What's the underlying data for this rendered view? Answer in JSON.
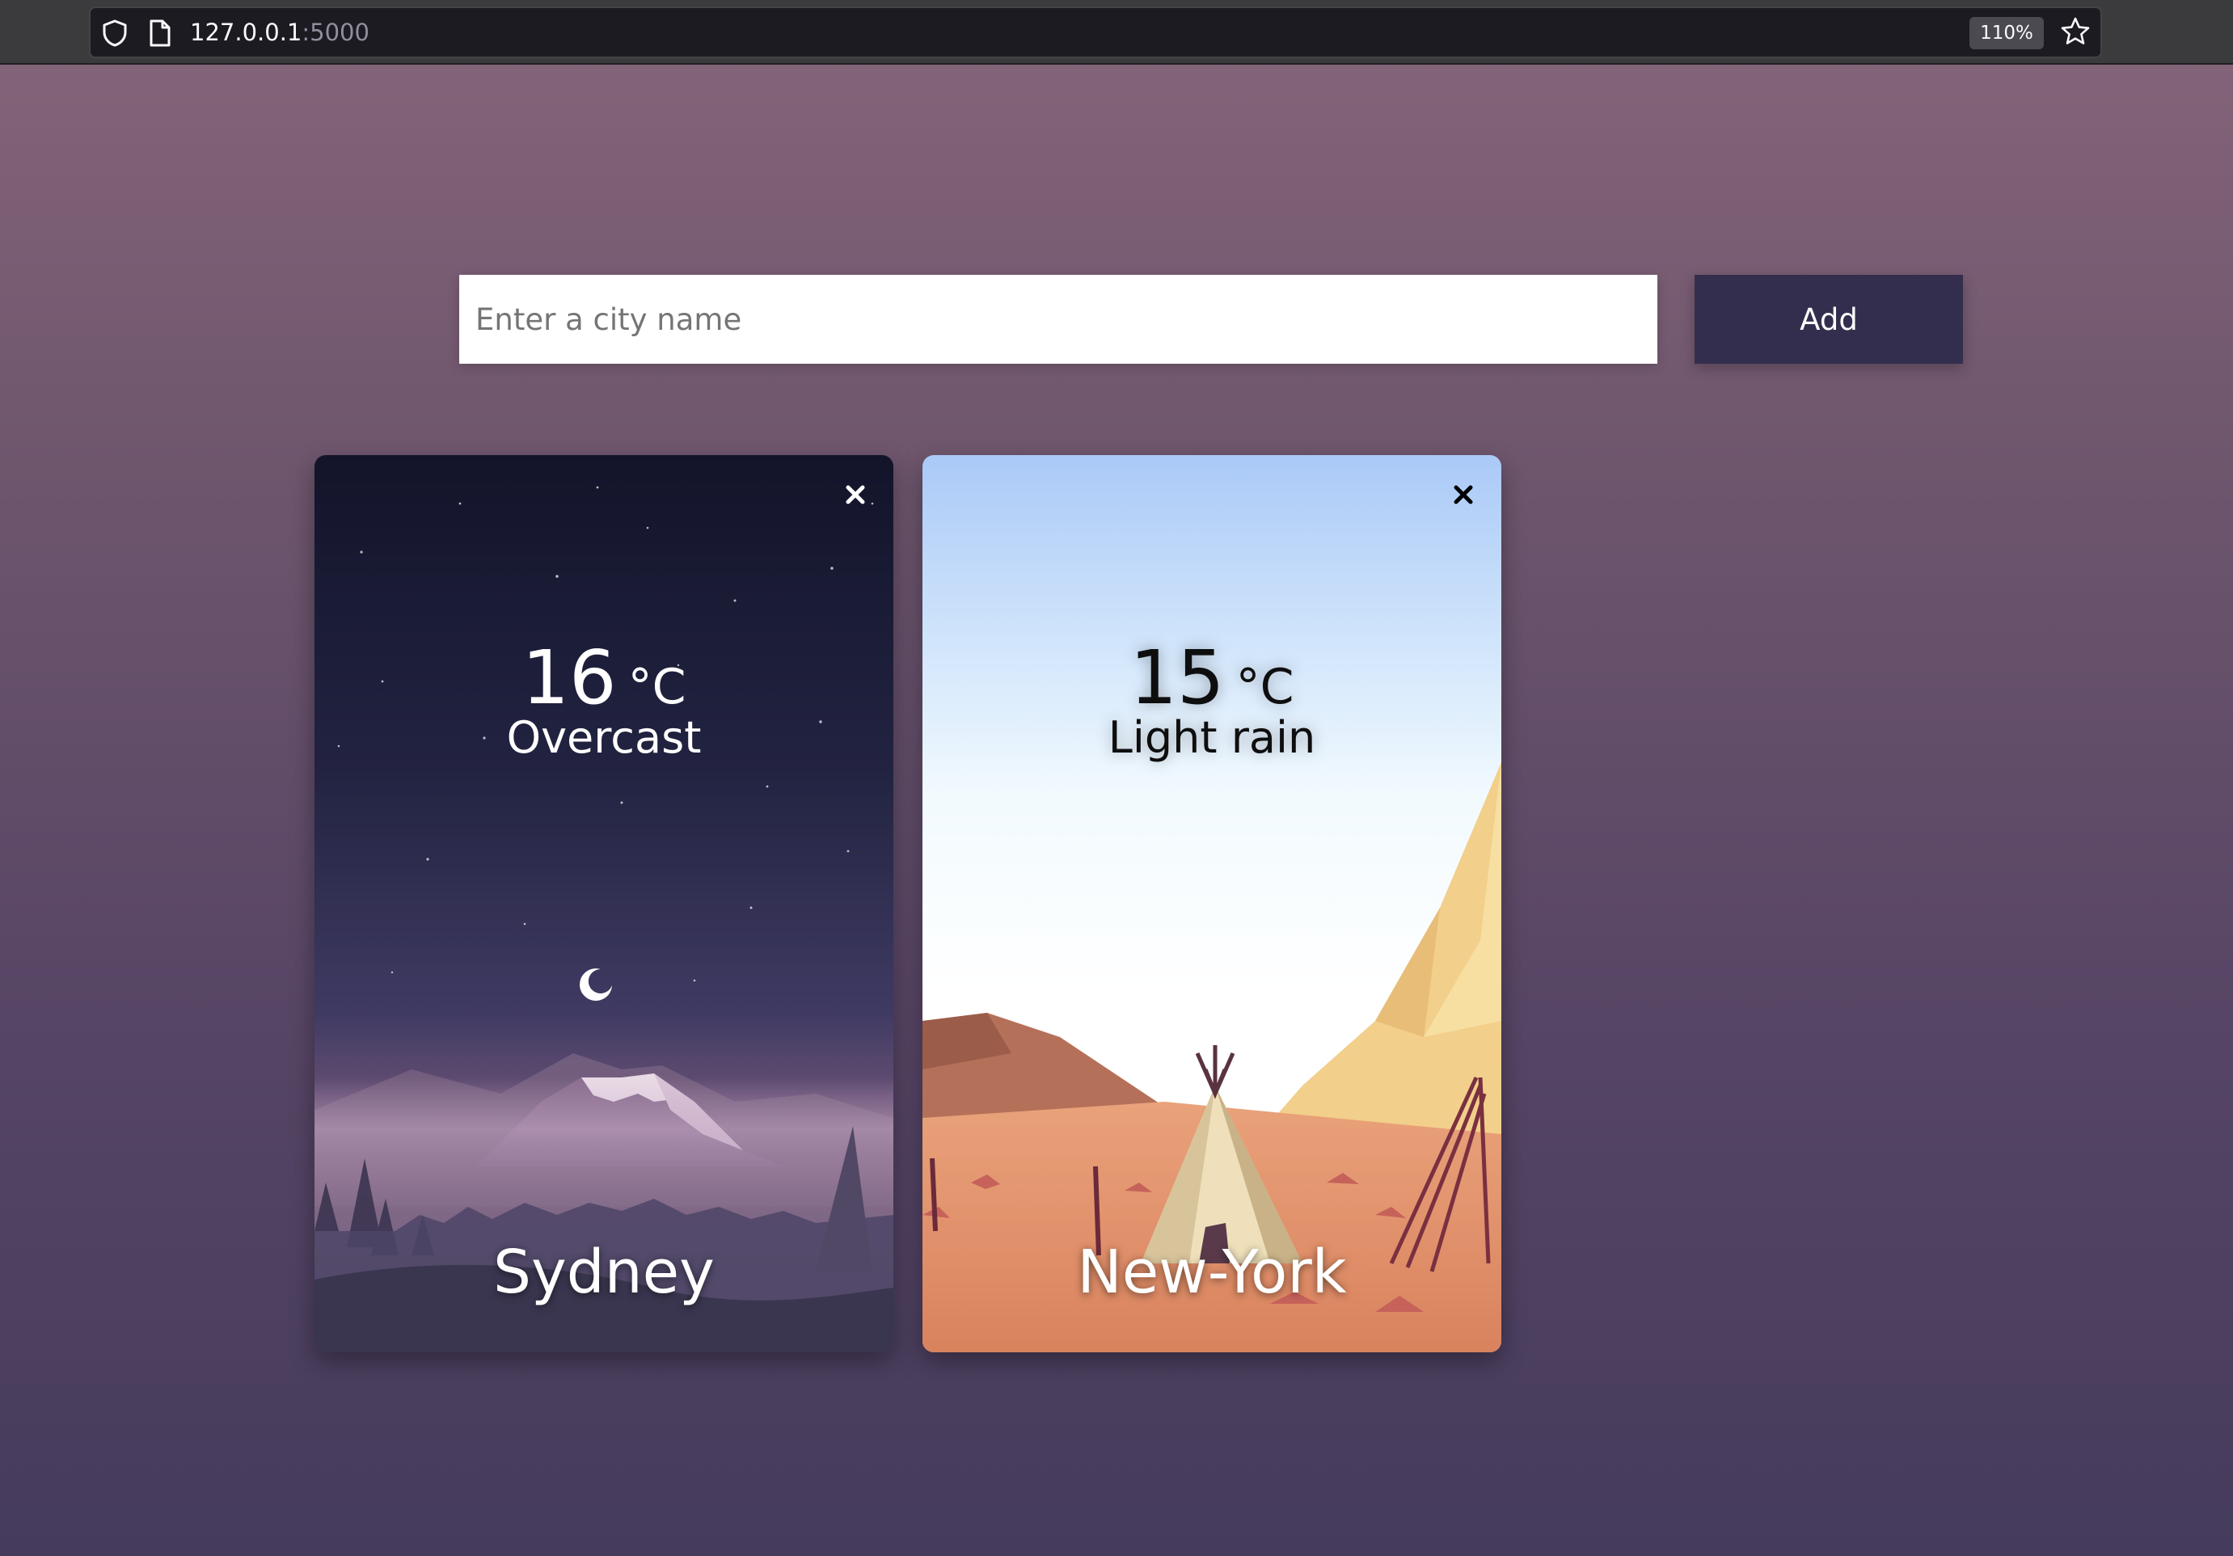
{
  "browser": {
    "url_host": "127.0.0.1",
    "url_port": ":5000",
    "zoom": "110%"
  },
  "search": {
    "placeholder": "Enter a city name",
    "value": "",
    "add_label": "Add"
  },
  "cards": [
    {
      "city": "Sydney",
      "temperature": "16",
      "unit": "°C",
      "condition": "Overcast",
      "scene": "night-mountain"
    },
    {
      "city": "New-York",
      "temperature": "15",
      "unit": "°C",
      "condition": "Light rain",
      "scene": "desert-teepee"
    }
  ],
  "icons": {
    "close": "close-icon",
    "shield": "shield-icon",
    "page": "page-icon",
    "star": "star-icon"
  },
  "colors": {
    "background_top": "#86657a",
    "background_bottom": "#453b5c",
    "button": "#342e4e"
  }
}
